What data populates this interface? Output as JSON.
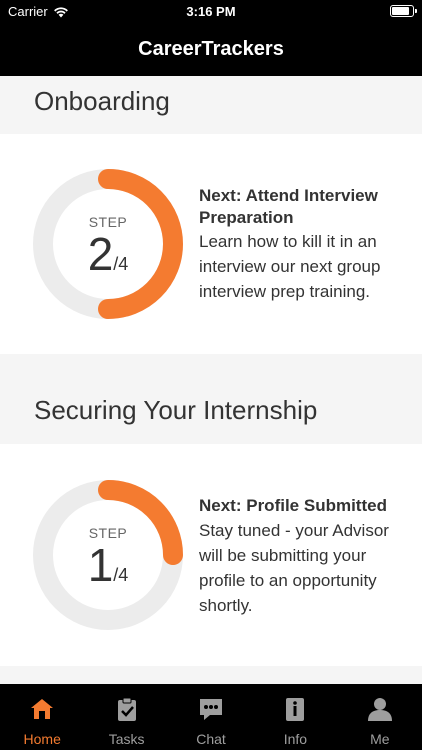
{
  "status_bar": {
    "carrier": "Carrier",
    "time": "3:16 PM",
    "battery_level": 0.9
  },
  "nav": {
    "title": "CareerTrackers"
  },
  "colors": {
    "accent": "#f47b30",
    "track": "#ececec",
    "inactive": "#9e9e9e"
  },
  "sections": [
    {
      "title": "Onboarding",
      "step_label": "STEP",
      "step_current": "2",
      "step_total": "/4",
      "progress": 0.5,
      "next_title": "Next: Attend Interview Preparation",
      "next_description": "Learn how to kill it in an interview our next group interview prep training."
    },
    {
      "title": "Securing Your Internship",
      "step_label": "STEP",
      "step_current": "1",
      "step_total": "/4",
      "progress": 0.25,
      "next_title": "Next: Profile Submitted",
      "next_description": "Stay tuned - your Advisor will be submitting your profile to an opportunity shortly."
    }
  ],
  "tabs": [
    {
      "label": "Home",
      "icon": "home-icon",
      "active": true
    },
    {
      "label": "Tasks",
      "icon": "clipboard-check-icon",
      "active": false
    },
    {
      "label": "Chat",
      "icon": "chat-bubble-icon",
      "active": false
    },
    {
      "label": "Info",
      "icon": "info-book-icon",
      "active": false
    },
    {
      "label": "Me",
      "icon": "person-icon",
      "active": false
    }
  ]
}
